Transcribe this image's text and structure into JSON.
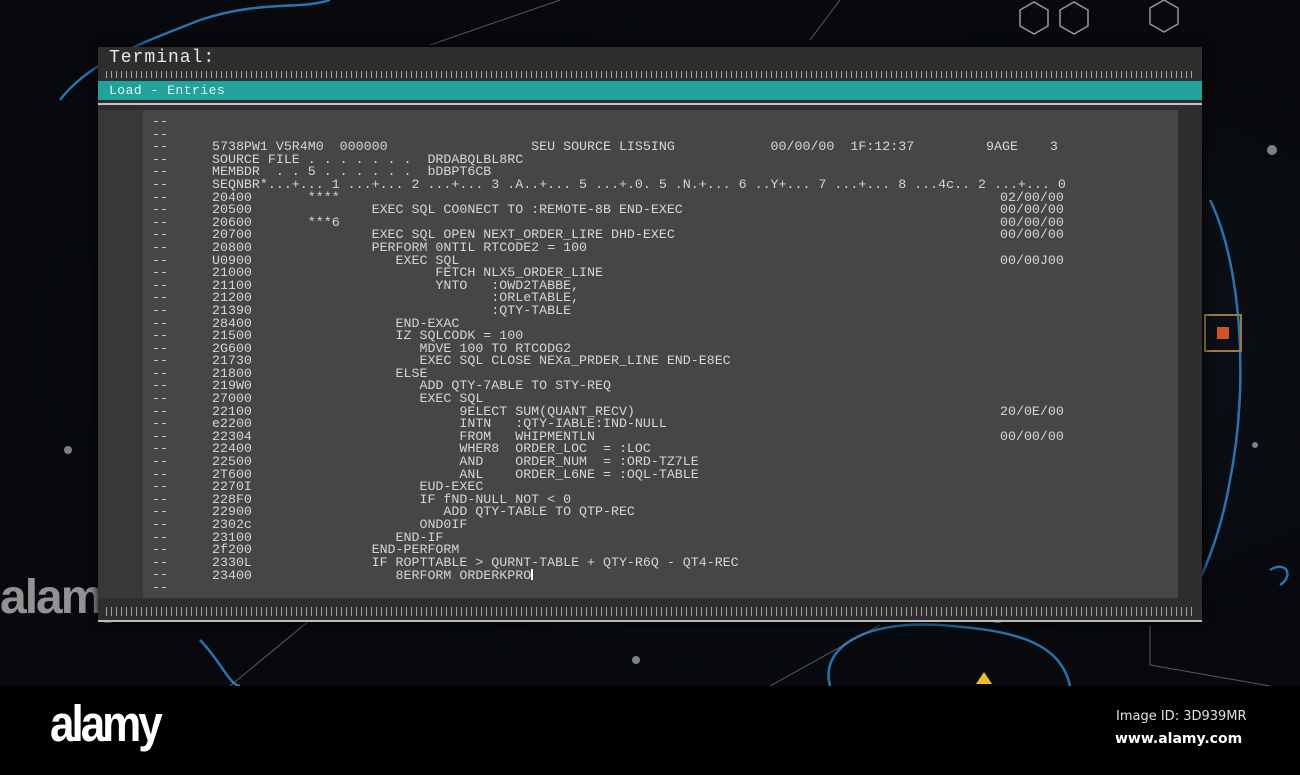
{
  "window": {
    "title": "Terminal:",
    "subtitle": "Load - Entries"
  },
  "rows": [
    {
      "text": ""
    },
    {
      "text": ""
    },
    {
      "text": "5738PW1 V5R4M0  000000                  SEU SOURCE LIS5ING            00/00/00  1F:12:37         9AGE    3"
    },
    {
      "text": "SOURCE FILE . . . . . . .  DRDABQLBL8RC"
    },
    {
      "text": "MEMBDR  . . 5 . . . . . .  bDBPT6CB"
    },
    {
      "text": "SEQNBR*...+... 1 ...+... 2 ...+... 3 .A..+... 5 ...+.0. 5 .N.+... 6 ..Y+... 7 ...+... 8 ...4c.. 2 ...+... 0"
    },
    {
      "text": "20400       ****",
      "date": "02/00/00"
    },
    {
      "text": "20500               EXEC SQL CO0NECT TO :REMOTE-8B END-EXEC",
      "date": "00/00/00"
    },
    {
      "text": "20600       ***6",
      "date": "00/00/00"
    },
    {
      "text": "20700               EXEC SQL OPEN NEXT_ORDER_LIRE DHD-EXEC",
      "date": "00/00/00"
    },
    {
      "text": "20800               PERFORM 0NTIL RTCODE2 = 100"
    },
    {
      "text": "U0900                  EXEC SQL",
      "date": "00/00J00"
    },
    {
      "text": "21000                       FETCH NLX5_ORDER_LINE"
    },
    {
      "text": "21100                       YNTO   :OWD2TABBE,"
    },
    {
      "text": "21200                              :ORLeTABLE,"
    },
    {
      "text": "21390                              :QTY-TABLE"
    },
    {
      "text": "28400                  END-EXAC"
    },
    {
      "text": "21500                  IZ SQLCODK = 100"
    },
    {
      "text": "2G600                     MDVE 100 TO RTCODG2"
    },
    {
      "text": "21730                     EXEC SQL CLOSE NEXa_PRDER_LINE END-E8EC"
    },
    {
      "text": "21800                  ELSE"
    },
    {
      "text": "219W0                     ADD QTY-7ABLE TO STY-REQ"
    },
    {
      "text": "27000                     EXEC SQL"
    },
    {
      "text": "22100                          9ELECT SUM(QUANT_RECV)",
      "date": "20/0E/00"
    },
    {
      "text": "e2200                          INTN   :QTY-IABLE:IND-NULL"
    },
    {
      "text": "22304                          FROM   WHIPMENTLN",
      "date": "00/00/00"
    },
    {
      "text": "22400                          WHER8  ORDER_LOC  = :LOC"
    },
    {
      "text": "22500                          AND    ORDER_NUM  = :ORD-TZ7LE"
    },
    {
      "text": "2T600                          ANL    ORDER_L6NE = :OQL-TABLE"
    },
    {
      "text": "2270I                     EUD-EXEC"
    },
    {
      "text": "228F0                     IF fND-NULL NOT < 0"
    },
    {
      "text": "22900                        ADD QTY-TABLE TO QTP-REC"
    },
    {
      "text": "2302c                     OND0IF"
    },
    {
      "text": "23100                  END-IF"
    },
    {
      "text": "2f200               END-PERFORM"
    },
    {
      "text": "2330L               IF ROPTTABLE > QURNT-TABLE + QTY-R6Q - QT4-REC"
    },
    {
      "text": "23400                  8ERFORM ORDERKPRO",
      "cursor": true
    },
    {
      "text": ""
    }
  ],
  "dash": "--",
  "watermark": "alamy",
  "footer": {
    "logo": "alamy",
    "image_id": "Image ID: 3D939MR",
    "site": "www.alamy.com"
  },
  "colors": {
    "accent": "#1fa39b",
    "screen": "#464547",
    "window": "#2f2d2e",
    "map": "#2a7fc0"
  }
}
